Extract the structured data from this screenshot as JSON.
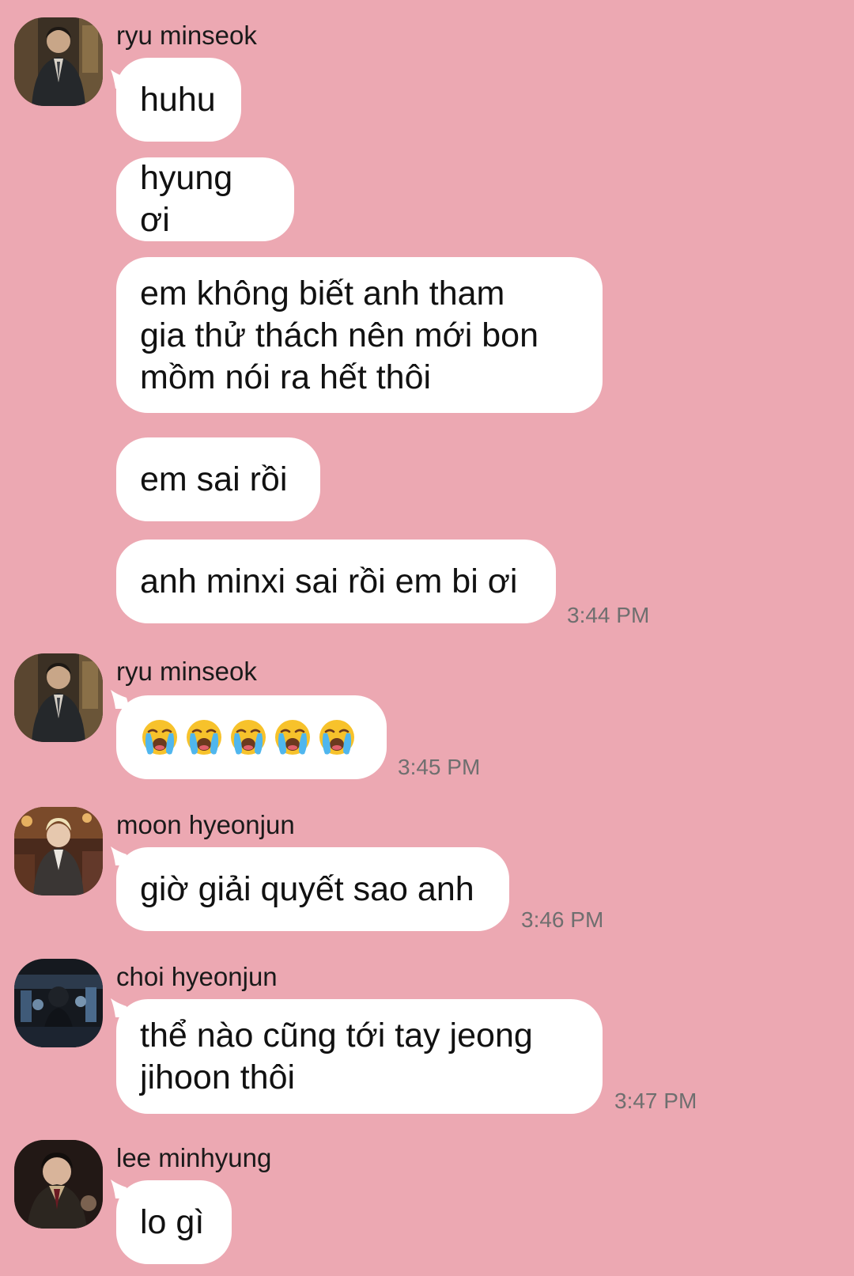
{
  "colors": {
    "background": "#eca8b2",
    "bubble": "#ffffff",
    "timestamp": "#6f6f6f"
  },
  "messages": [
    {
      "sender": "ryu minseok",
      "avatar_icon": "avatar-ryu-minseok",
      "bubbles": [
        "huhu",
        "hyung ơi",
        "em không biết anh tham\ngia thử thách nên mới bon\nmồm nói ra hết thôi",
        "em sai rồi",
        "anh minxi sai rồi em bi ơi"
      ],
      "time": "3:44 PM"
    },
    {
      "sender": "ryu minseok",
      "avatar_icon": "avatar-ryu-minseok",
      "emoji": {
        "icon": "loudly-crying-face-icon",
        "count": 5
      },
      "time": "3:45 PM"
    },
    {
      "sender": "moon hyeonjun",
      "avatar_icon": "avatar-moon-hyeonjun",
      "bubbles": [
        "giờ giải quyết sao anh"
      ],
      "time": "3:46 PM"
    },
    {
      "sender": "choi hyeonjun",
      "avatar_icon": "avatar-choi-hyeonjun",
      "bubbles": [
        "thể nào cũng tới tay jeong\njihoon thôi"
      ],
      "time": "3:47 PM"
    },
    {
      "sender": "lee minhyung",
      "avatar_icon": "avatar-lee-minhyung",
      "bubbles": [
        "lo gì"
      ]
    }
  ]
}
